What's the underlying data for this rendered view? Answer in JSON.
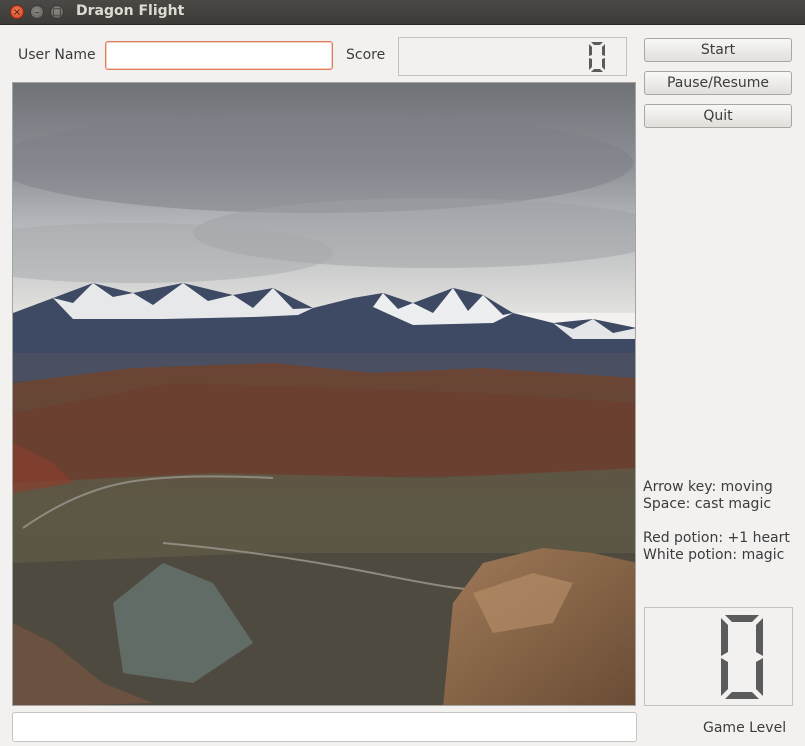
{
  "window": {
    "title": "Dragon Flight",
    "controls": {
      "close": "×",
      "minimize": "–",
      "maximize": "□"
    }
  },
  "header": {
    "user_name_label": "User Name",
    "user_name_value": "",
    "score_label": "Score",
    "score_value": "0"
  },
  "buttons": {
    "start": "Start",
    "pause_resume": "Pause/Resume",
    "quit": "Quit"
  },
  "instructions": {
    "line1": "Arrow key: moving",
    "line2": "Space: cast magic",
    "line3": "Red potion: +1 heart",
    "line4": "White potion: magic"
  },
  "level": {
    "value": "0",
    "label": "Game Level"
  },
  "status_bar": {
    "value": ""
  },
  "colors": {
    "titlebar": "#3c3b37",
    "window_bg": "#f2f1f0",
    "focus_border": "#dd7d5a",
    "lcd_segment": "#5b5b5b"
  }
}
